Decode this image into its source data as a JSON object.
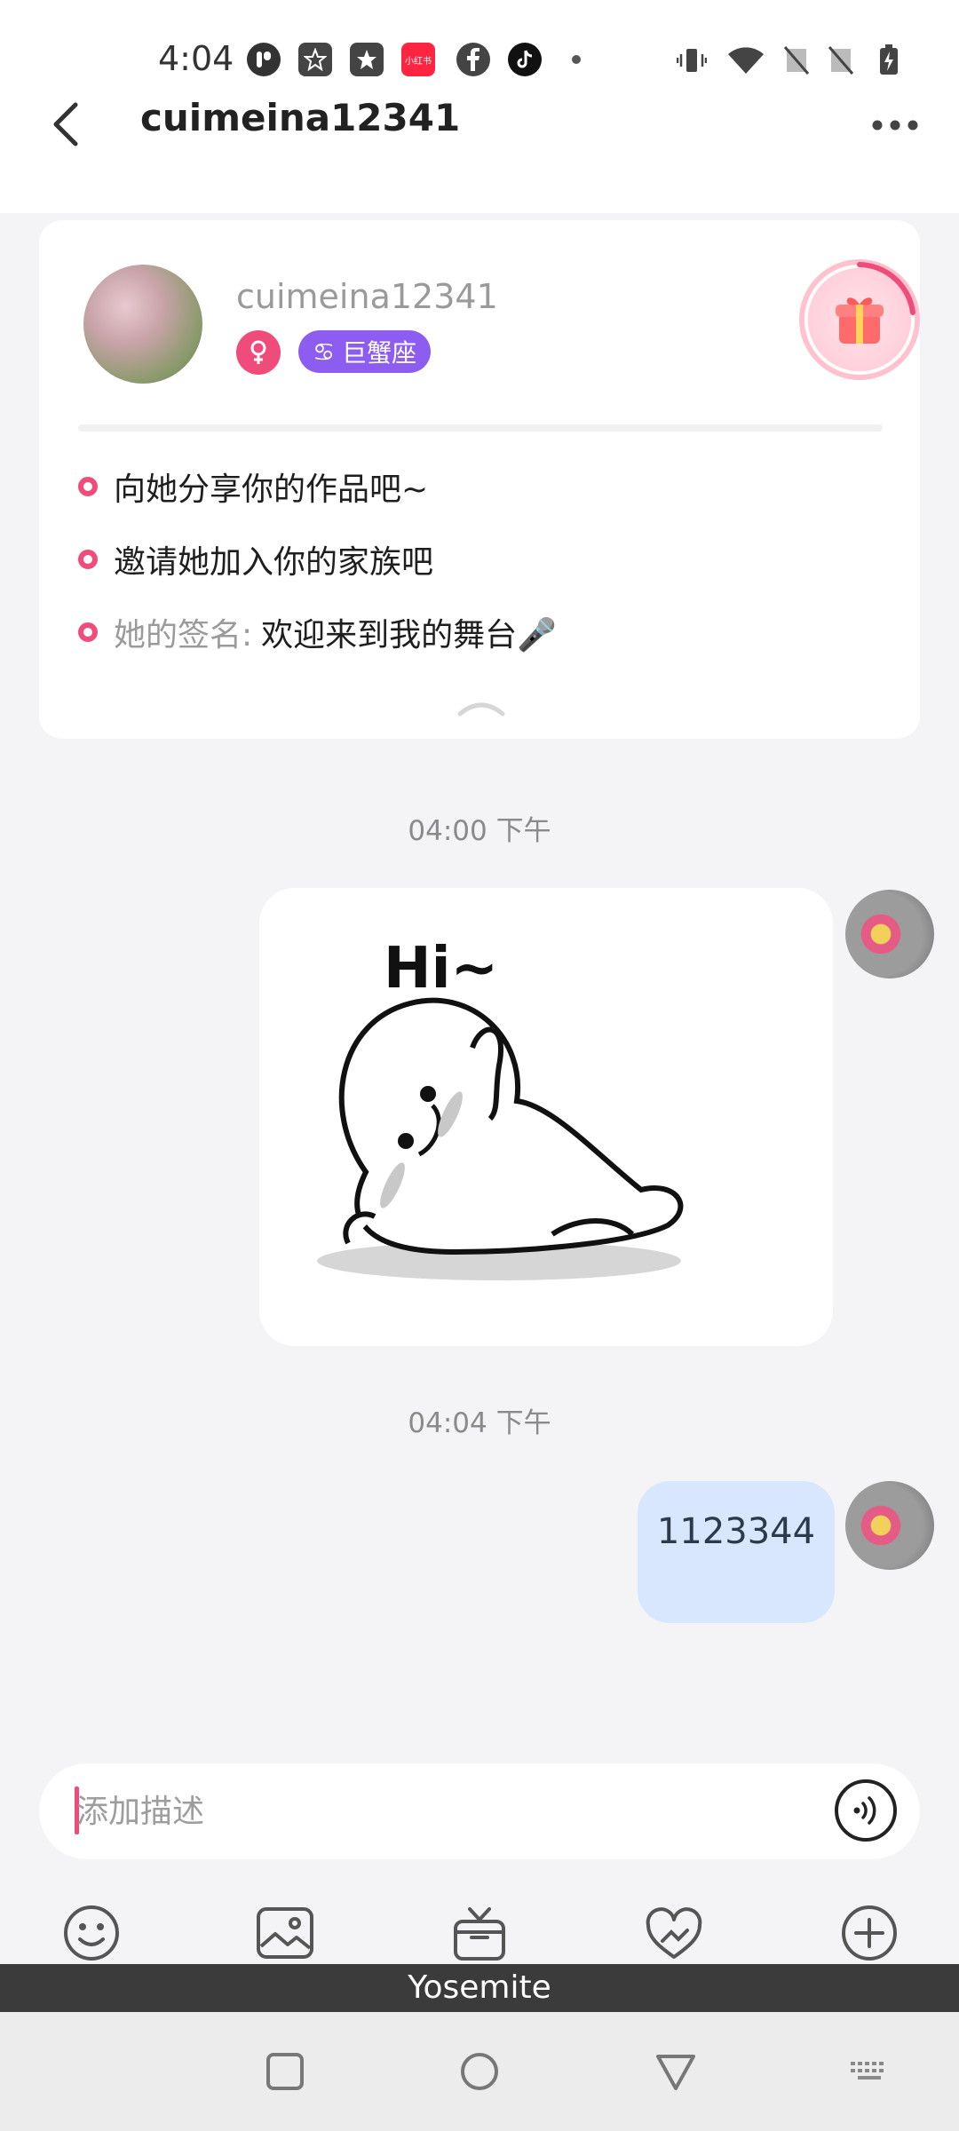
{
  "status_bar": {
    "time": "4:04",
    "notification_icons": [
      "p-app-icon",
      "star-app-icon",
      "star-app-icon-2",
      "xiaohongshu-icon",
      "facebook-icon",
      "tiktok-icon",
      "more-dot-icon"
    ],
    "xiaohongshu_label": "小红书",
    "system_icons": [
      "vibrate-icon",
      "wifi-icon",
      "no-sim-icon",
      "no-sim-icon-2",
      "battery-charging-icon"
    ]
  },
  "header": {
    "title": "cuimeina12341"
  },
  "profile_card": {
    "username": "cuimeina12341",
    "zodiac": "巨蟹座",
    "zodiac_symbol": "♋",
    "rows": [
      {
        "text": "向她分享你的作品吧~"
      },
      {
        "text": "邀请她加入你的家族吧"
      }
    ],
    "signature_label": "她的签名:",
    "signature_value": "欢迎来到我的舞台🎤"
  },
  "messages": [
    {
      "timestamp": "04:00 下午",
      "type": "sticker",
      "sticker_text": "Hi~"
    },
    {
      "timestamp": "04:04 下午",
      "type": "text",
      "text": "1123344"
    }
  ],
  "input": {
    "placeholder": "添加描述",
    "value": ""
  },
  "keyboard_label": "Yosemite",
  "colors": {
    "accent": "#ef4c7b",
    "zodiac_badge": "#8d5cf0",
    "bubble": "#d8e7fd",
    "background": "#f4f4f6"
  }
}
